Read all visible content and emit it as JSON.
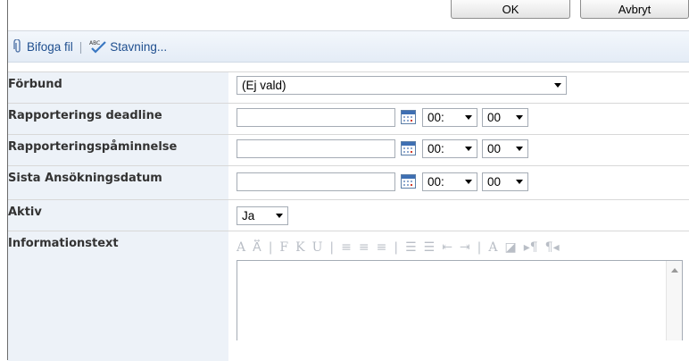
{
  "dialog_buttons": {
    "ok_label": "OK",
    "cancel_label": "Avbryt"
  },
  "toolbar": {
    "attach_label": "Bifoga fil",
    "separator": "|",
    "spelling_label": "Stavning..."
  },
  "fields": {
    "forbund": {
      "label": "Förbund",
      "selected": "(Ej vald)"
    },
    "deadline": {
      "label": "Rapporterings deadline",
      "date": "",
      "hour": "00:",
      "minute": "00"
    },
    "reminder": {
      "label": "Rapporteringspåminnelse",
      "date": "",
      "hour": "00:",
      "minute": "00"
    },
    "last_date": {
      "label": "Sista Ansökningsdatum",
      "date": "",
      "hour": "00:",
      "minute": "00"
    },
    "aktiv": {
      "label": "Aktiv",
      "selected": "Ja"
    },
    "info": {
      "label": "Informationstext",
      "value": ""
    }
  },
  "rte_tools": [
    "A",
    "A⃡",
    "|",
    "F",
    "K",
    "U",
    "|",
    "≡",
    "≡",
    "≡",
    "|",
    "☰",
    "☰",
    "⇤",
    "⇥",
    "|",
    "A",
    "◪",
    "▸¶",
    "¶◂"
  ],
  "colors": {
    "label_bg": "#edf2f8",
    "toolbar_text": "#1f4f8f",
    "disabled_tool": "#b9bec6"
  }
}
